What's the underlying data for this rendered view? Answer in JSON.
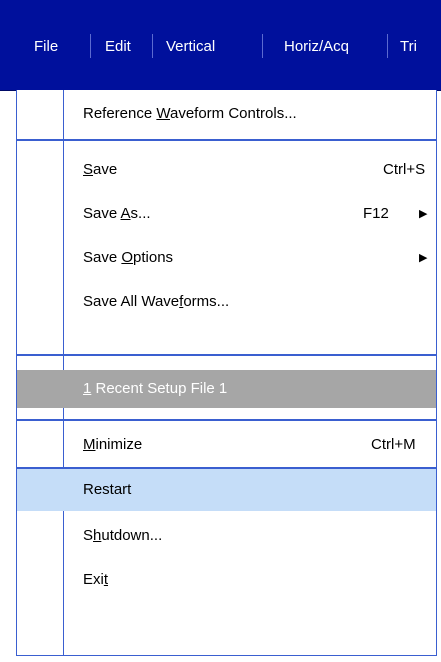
{
  "menubar": {
    "items": [
      "File",
      "Edit",
      "Vertical",
      "Horiz/Acq",
      "Tri"
    ]
  },
  "menu": {
    "items": [
      {
        "label_parts": [
          "Reference ",
          "W",
          "aveform Controls..."
        ],
        "shortcut": "",
        "submenu": false
      },
      {
        "label_parts": [
          "",
          "S",
          "ave"
        ],
        "shortcut": "Ctrl+S",
        "submenu": false
      },
      {
        "label_parts": [
          "Save ",
          "A",
          "s..."
        ],
        "shortcut": "F12",
        "submenu": true
      },
      {
        "label_parts": [
          "Save ",
          "O",
          "ptions"
        ],
        "shortcut": "",
        "submenu": true
      },
      {
        "label_parts": [
          "Save All Wave",
          "f",
          "orms..."
        ],
        "shortcut": "",
        "submenu": false
      },
      {
        "label_parts": [
          "",
          "1",
          " Recent Setup File 1"
        ],
        "shortcut": "",
        "submenu": false,
        "disabled": true
      },
      {
        "label_parts": [
          "",
          "M",
          "inimize"
        ],
        "shortcut": "Ctrl+M",
        "submenu": false
      },
      {
        "label_parts": [
          "Restart",
          "",
          ""
        ],
        "shortcut": "",
        "submenu": false,
        "highlighted": true
      },
      {
        "label_parts": [
          "S",
          "h",
          "utdown..."
        ],
        "shortcut": "",
        "submenu": false
      },
      {
        "label_parts": [
          "Exi",
          "t",
          ""
        ],
        "shortcut": "",
        "submenu": false
      }
    ]
  },
  "colors": {
    "menubar_bg": "#00109c",
    "accent_line": "#3a5fd0",
    "disabled_bg": "#a6a6a6",
    "highlight_bg": "#c5ddf8"
  },
  "icons": {
    "submenu_arrow": "▶"
  }
}
